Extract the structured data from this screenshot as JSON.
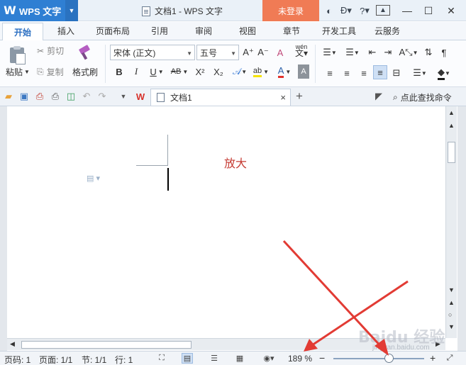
{
  "titlebar": {
    "app_name": "WPS 文字",
    "doc_title": "文档1 - WPS 文字",
    "login_label": "未登录",
    "help_label": "?"
  },
  "tabs": [
    {
      "label": "开始",
      "active": true
    },
    {
      "label": "插入"
    },
    {
      "label": "页面布局"
    },
    {
      "label": "引用"
    },
    {
      "label": "审阅"
    },
    {
      "label": "视图"
    },
    {
      "label": "章节"
    },
    {
      "label": "开发工具"
    },
    {
      "label": "云服务"
    }
  ],
  "ribbon": {
    "paste_label": "粘贴",
    "cut_label": "剪切",
    "copy_label": "复制",
    "format_painter_label": "格式刷",
    "font_name": "宋体 (正文)",
    "font_size": "五号",
    "bold": "B",
    "italic": "I",
    "underline": "U",
    "strikethrough": "AB",
    "superscript": "X²",
    "subscript": "X₂",
    "grow_font": "A⁺",
    "shrink_font": "A⁻",
    "clear_format": "A",
    "phonetic_label": "wén",
    "font_color": "A",
    "highlight": "ab",
    "shading": "A"
  },
  "quickbar": {
    "doc_tab_label": "文档1",
    "close_label": "×",
    "new_tab_label": "+",
    "search_command_label": "点此查找命令"
  },
  "document": {
    "annotation_text": "放大"
  },
  "statusbar": {
    "page_no": "页码: 1",
    "pages": "页面: 1/1",
    "section": "节: 1/1",
    "line": "行: 1",
    "zoom": "189 %",
    "zoom_level_percent": 189,
    "zoom_minus": "−",
    "zoom_plus": "+"
  },
  "watermark": {
    "brand": "Baidu 经验",
    "url": "jingyan.baidu.com"
  },
  "colors": {
    "accent_blue": "#2f7fd3",
    "login_orange": "#f07b55",
    "annotation_red": "#c53a32",
    "arrow_red": "#e23b34"
  }
}
